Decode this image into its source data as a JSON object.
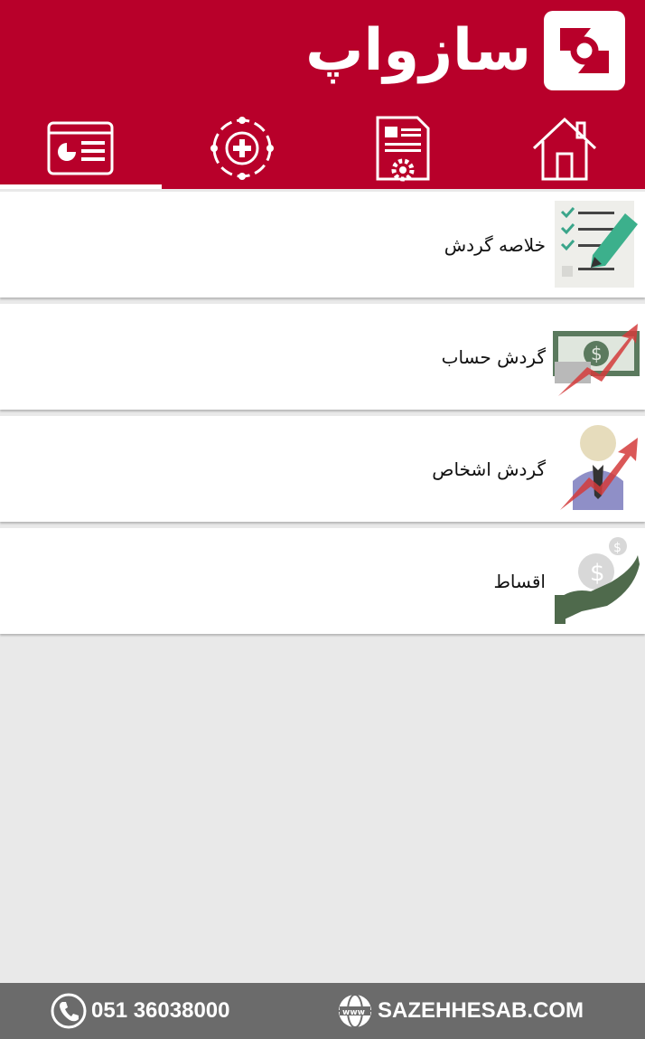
{
  "header": {
    "logo_text": "سازواپ",
    "brand_color": "#b8002a"
  },
  "tabs": [
    {
      "icon": "dashboard-card-icon",
      "active": true
    },
    {
      "icon": "circle-plus-icon",
      "active": false
    },
    {
      "icon": "document-gear-icon",
      "active": false
    },
    {
      "icon": "home-icon",
      "active": false
    }
  ],
  "menu": {
    "items": [
      {
        "label": "خلاصه گردش",
        "icon": "checklist-marker-icon"
      },
      {
        "label": "گردش حساب",
        "icon": "money-growth-icon"
      },
      {
        "label": "گردش اشخاص",
        "icon": "person-growth-icon"
      },
      {
        "label": "اقساط",
        "icon": "hand-coins-icon"
      }
    ]
  },
  "footer": {
    "phone": "051 36038000",
    "website": "SAZEHHESAB.COM",
    "phone_icon": "phone-icon",
    "web_icon": "globe-www-icon"
  }
}
